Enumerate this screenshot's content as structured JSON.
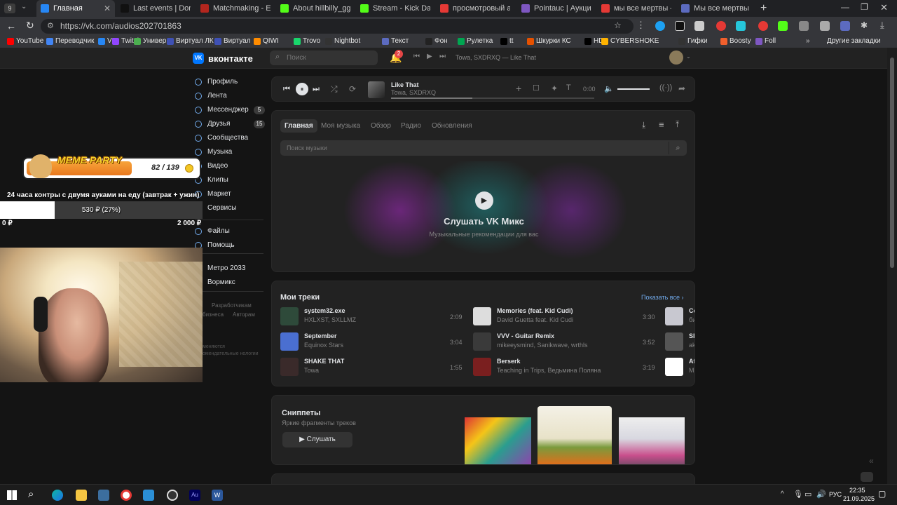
{
  "browser": {
    "tab_count": "9",
    "tabs": [
      {
        "label": "Главная",
        "color": "#2787f5"
      },
      {
        "label": "Last events | DonateP",
        "color": "#111111"
      },
      {
        "label": "Matchmaking - Europ",
        "color": "#b3261e"
      },
      {
        "label": "About hillbilly_gg - W",
        "color": "#53fc18"
      },
      {
        "label": "Stream - Kick Dashbo",
        "color": "#53fc18"
      },
      {
        "label": "просмотровый аук",
        "color": "#e53935"
      },
      {
        "label": "Pointauc | Аукцион д",
        "color": "#7e57c2"
      },
      {
        "label": "мы все мертвы – Ян",
        "color": "#e53935"
      },
      {
        "label": "Мы все мертвы (сер",
        "color": "#5c6bc0"
      }
    ],
    "url": "https://vk.com/audios202701863"
  },
  "bookmarks": [
    {
      "label": "YouTube",
      "color": "#ff0000"
    },
    {
      "label": "Переводчик",
      "color": "#4285f4"
    },
    {
      "label": "VK",
      "color": "#2787f5"
    },
    {
      "label": "Twitch",
      "color": "#9146ff"
    },
    {
      "label": "Универ",
      "color": "#4caf50"
    },
    {
      "label": "Виртуал ЛК",
      "color": "#3f51b5"
    },
    {
      "label": "Виртуал",
      "color": "#3f51b5"
    },
    {
      "label": "QIWI",
      "color": "#ff8c00"
    },
    {
      "label": "Trovo",
      "color": "#19d66b"
    },
    {
      "label": "Nightbot",
      "color": "#333333"
    },
    {
      "label": "Текст",
      "color": "#5c6bc0"
    },
    {
      "label": "Фон",
      "color": "#222222"
    },
    {
      "label": "Рулетка",
      "color": "#00a651"
    },
    {
      "label": "tt",
      "color": "#000000"
    },
    {
      "label": "Шкурки КС",
      "color": "#e65100"
    },
    {
      "label": "HD",
      "color": "#000000"
    },
    {
      "label": "CYBERSHOKE",
      "color": "#ffb300"
    },
    {
      "label": "Гифки",
      "color": "#333333"
    },
    {
      "label": "Boosty",
      "color": "#f15f2c"
    },
    {
      "label": "Foll",
      "color": "#7e57c2"
    }
  ],
  "other_bookmarks": "Другие закладки",
  "vk": {
    "logo": "вконтакте",
    "search_placeholder": "Поиск",
    "notifications_count": "2",
    "header_track": "Towa, SXDRXQ — Like That",
    "nav": [
      {
        "label": "Профиль",
        "badge": ""
      },
      {
        "label": "Лента",
        "badge": ""
      },
      {
        "label": "Мессенджер",
        "badge": "5"
      },
      {
        "label": "Друзья",
        "badge": "15"
      },
      {
        "label": "Сообщества",
        "badge": ""
      },
      {
        "label": "Музыка",
        "badge": ""
      },
      {
        "label": "Видео",
        "badge": ""
      },
      {
        "label": "Клипы",
        "badge": ""
      },
      {
        "label": "Маркет",
        "badge": ""
      },
      {
        "label": "Сервисы",
        "badge": ""
      },
      {
        "label": "Файлы",
        "badge": ""
      },
      {
        "label": "Помощь",
        "badge": ""
      },
      {
        "label": "Метро 2033",
        "badge": ""
      },
      {
        "label": "Вормикс",
        "badge": ""
      }
    ],
    "footer_links": [
      "Разработчикам",
      "бизнеса",
      "Авторам"
    ],
    "footer_note": "меняются омендательные нологии",
    "player": {
      "title": "Like That",
      "artist": "Towa, SXDRXQ",
      "time": "0:00"
    },
    "tabs": [
      "Главная",
      "Моя музыка",
      "Обзор",
      "Радио",
      "Обновления"
    ],
    "music_search_placeholder": "Поиск музыки",
    "mix": {
      "title": "Слушать VK Микс",
      "subtitle": "Музыкальные рекомендации для вас"
    },
    "my_tracks": {
      "title": "Мои треки",
      "show_all": "Показать все",
      "items": [
        {
          "title": "system32.exe",
          "artist": "HXLXST, SXLLMZ",
          "duration": "2:09",
          "color": "#2e4a3a"
        },
        {
          "title": "September",
          "artist": "Equinox Stars",
          "duration": "3:04",
          "color": "#4a6fd1"
        },
        {
          "title": "SHAKE THAT",
          "artist": "Towa",
          "duration": "1:55",
          "color": "#3a2a2a"
        },
        {
          "title": "Memories (feat. Kid Cudi)",
          "artist": "David Guetta feat. Kid Cudi",
          "duration": "3:30",
          "color": "#dddddd"
        },
        {
          "title": "VVV - Guitar Remix",
          "artist": "mikeeysmind, Sanikwave, wrthls",
          "duration": "3:52",
          "color": "#3a3a3a"
        },
        {
          "title": "Berserk",
          "artist": "Teaching in Trips, Ведьмина Поляна",
          "duration": "3:19",
          "color": "#7a1f1f"
        },
        {
          "title": "Co",
          "artist": "би",
          "duration": "",
          "color": "#c8c8d0"
        },
        {
          "title": "Sle",
          "artist": "ak",
          "duration": "",
          "color": "#555555"
        },
        {
          "title": "Aft",
          "artist": "Mr",
          "duration": "",
          "color": "#ffffff"
        }
      ]
    },
    "snippets": {
      "title": "Сниппеты",
      "subtitle": "Яркие фрагменты треков",
      "button": "Слушать"
    }
  },
  "overlay": {
    "meme_party": "MEME PARTY",
    "meme_count": "82 / 139",
    "goal_text": "24 часа контры с двумя ауками на еду (завтрак + ужин)",
    "goal_amount": "530 ₽ (27%)",
    "goal_progress": 0.27,
    "goal_min": "0 ₽",
    "goal_max": "2 000 ₽"
  },
  "taskbar": {
    "language": "РУС",
    "time": "22:35",
    "date": "21.09.2025"
  }
}
